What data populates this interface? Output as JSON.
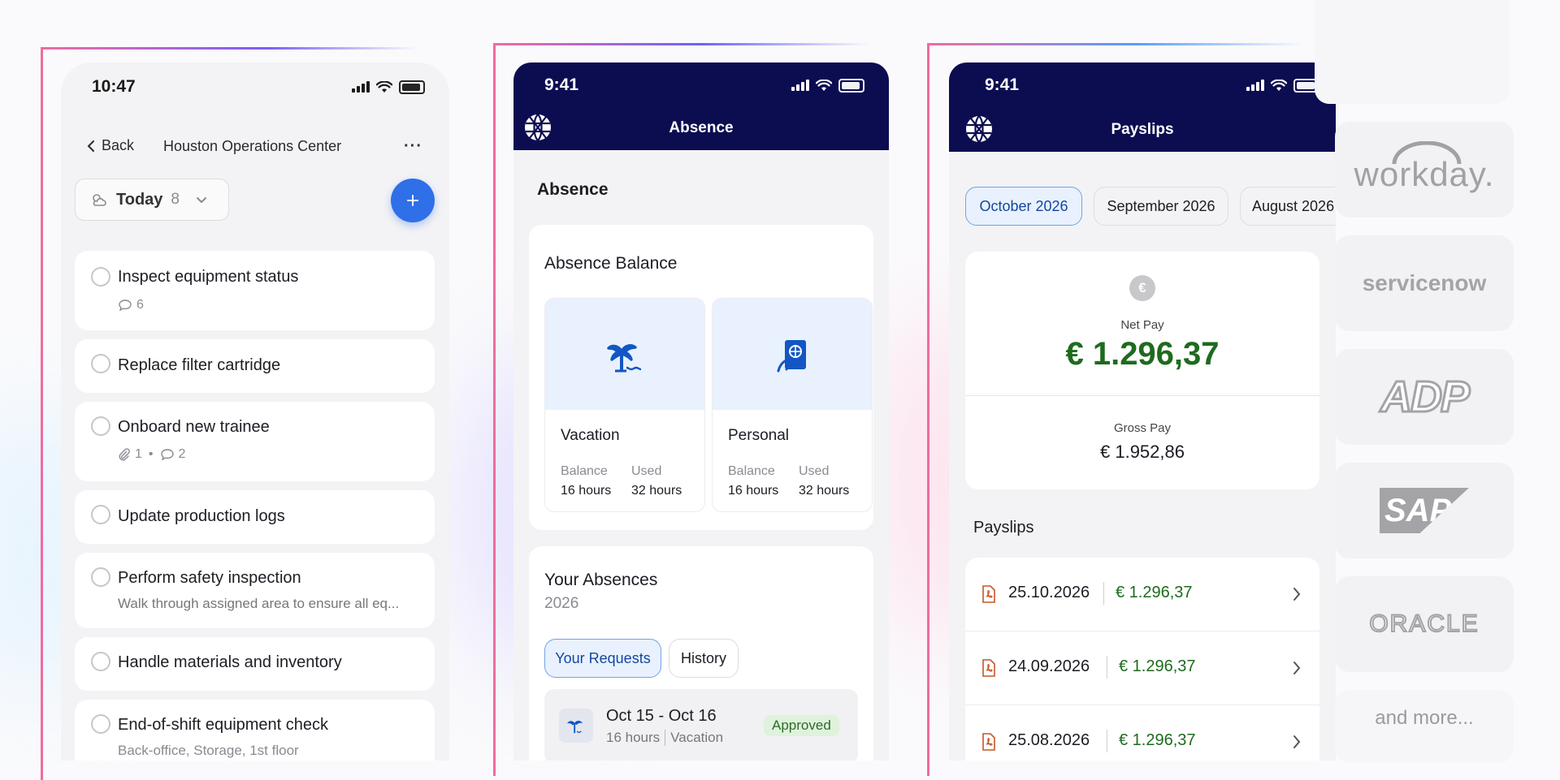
{
  "tasks_phone": {
    "time": "10:47",
    "back_label": "Back",
    "location": "Houston Operations Center",
    "filter_label": "Today",
    "filter_count": "8",
    "tasks": [
      {
        "title": "Inspect equipment status",
        "comments": "6"
      },
      {
        "title": "Replace filter cartridge"
      },
      {
        "title": "Onboard new trainee",
        "attachments": "1",
        "comments": "2"
      },
      {
        "title": "Update production logs"
      },
      {
        "title": "Perform safety inspection",
        "subtitle": "Walk through assigned area to ensure all eq..."
      },
      {
        "title": "Handle materials and inventory"
      },
      {
        "title": "End-of-shift equipment check",
        "subtitle": "Back-office, Storage, 1st floor"
      }
    ]
  },
  "absence_phone": {
    "time": "9:41",
    "header_title": "Absence",
    "section_title": "Absence",
    "balance_title": "Absence Balance",
    "balance_cards": [
      {
        "name": "Vacation",
        "balance_label": "Balance",
        "balance_value": "16 hours",
        "used_label": "Used",
        "used_value": "32 hours"
      },
      {
        "name": "Personal",
        "balance_label": "Balance",
        "balance_value": "16 hours",
        "used_label": "Used",
        "used_value": "32 hours"
      }
    ],
    "absences_title": "Your Absences",
    "absences_year": "2026",
    "tabs": [
      "Your Requests",
      "History"
    ],
    "request": {
      "dates": "Oct 15 - Oct 16",
      "hours": "16 hours",
      "type": "Vacation",
      "status": "Approved"
    }
  },
  "payslips_phone": {
    "time": "9:41",
    "header_title": "Payslips",
    "months": [
      "October 2026",
      "September 2026",
      "August 2026"
    ],
    "currency_symbol": "€",
    "net_label": "Net Pay",
    "net_value": "€ 1.296,37",
    "gross_label": "Gross Pay",
    "gross_value": "€ 1.952,86",
    "list_title": "Payslips",
    "list": [
      {
        "date": "25.10.2026",
        "amount": "€ 1.296,37"
      },
      {
        "date": "24.09.2026",
        "amount": "€ 1.296,37"
      },
      {
        "date": "25.08.2026",
        "amount": "€ 1.296,37"
      }
    ]
  },
  "integrations": [
    "workday.",
    "servicenow",
    "ADP",
    "SAP",
    "ORACLE",
    "and more..."
  ],
  "colors": {
    "navy": "#0c0d50",
    "accent_blue": "#2f6fe8",
    "money_green": "#1e6b1e",
    "approved_bg": "#dff2dc"
  }
}
